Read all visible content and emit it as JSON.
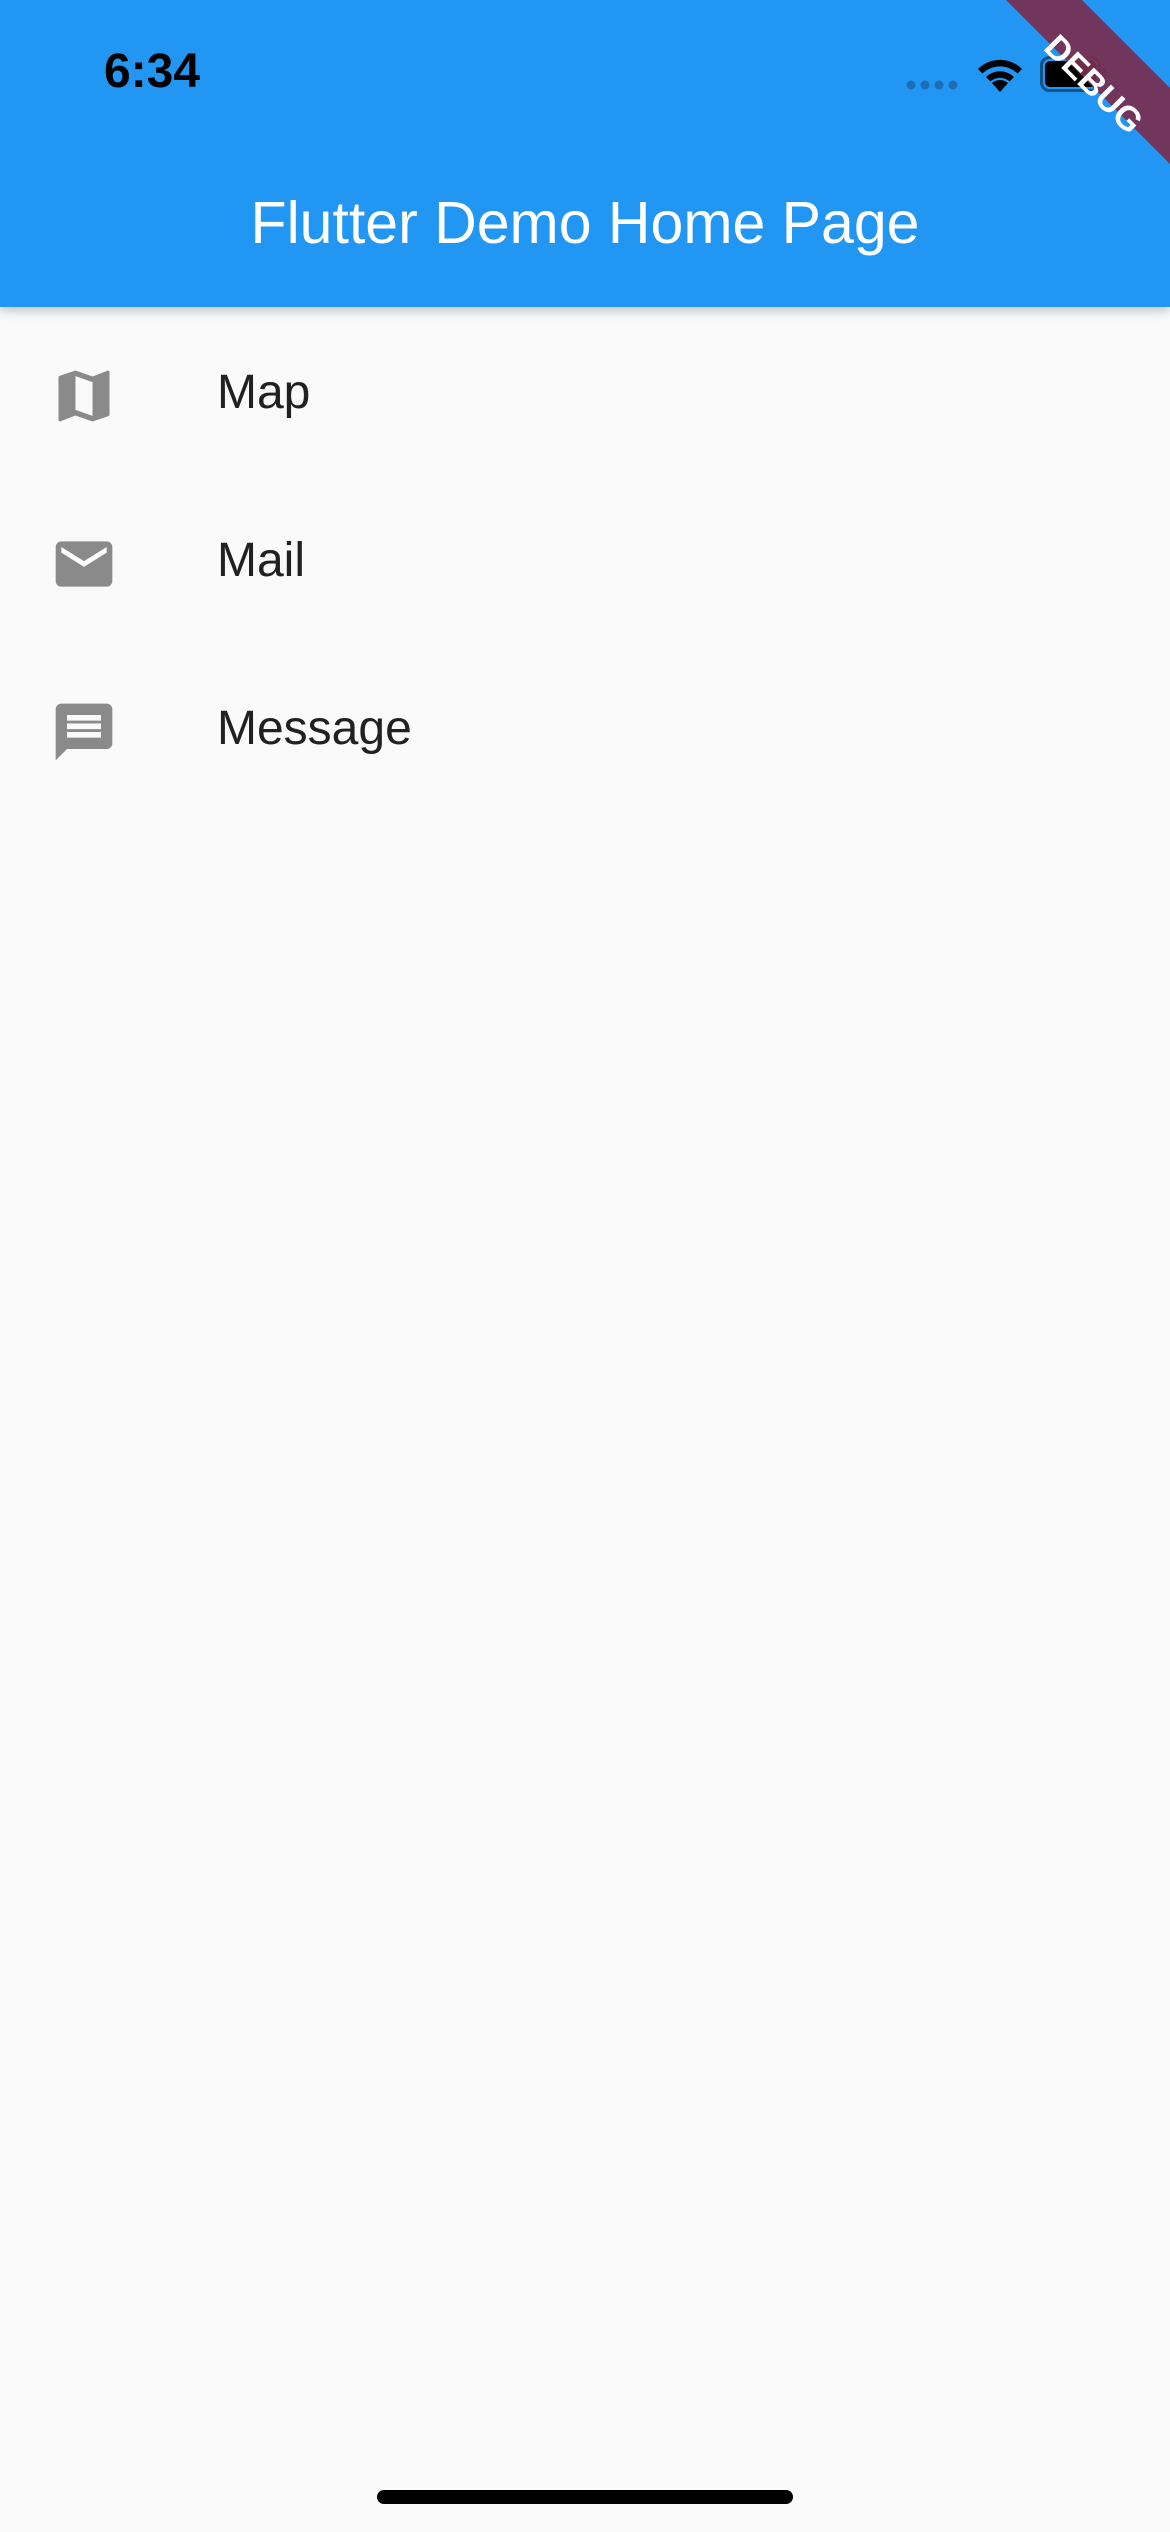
{
  "status_bar": {
    "time": "6:34"
  },
  "app_bar": {
    "title": "Flutter Demo Home Page",
    "color": "#2196f3"
  },
  "debug_banner": {
    "label": "DEBUG",
    "color": "#7a2d4f"
  },
  "list": {
    "items": [
      {
        "label": "Map",
        "icon": "map-icon"
      },
      {
        "label": "Mail",
        "icon": "mail-icon"
      },
      {
        "label": "Message",
        "icon": "message-icon"
      }
    ]
  },
  "colors": {
    "background": "#fafafa",
    "icon": "#8a8a8a",
    "text": "#212121"
  }
}
